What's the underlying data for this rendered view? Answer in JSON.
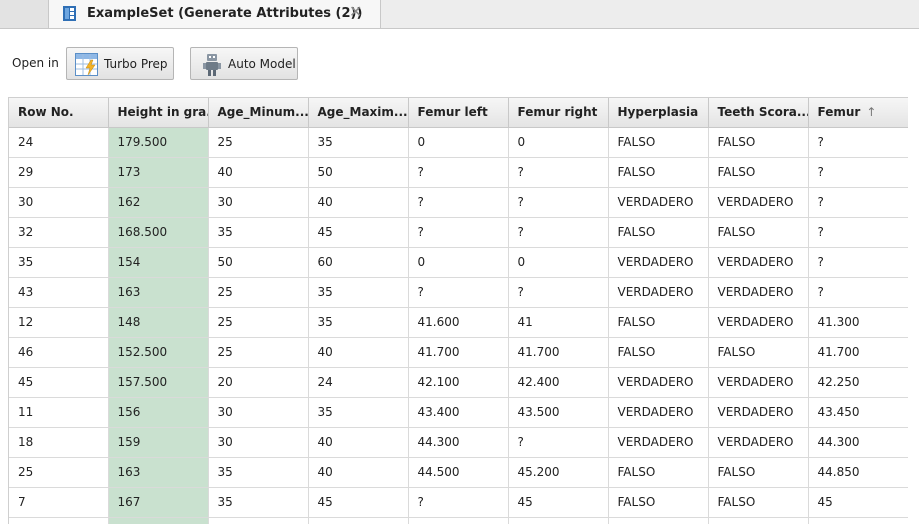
{
  "tab": {
    "title": "ExampleSet (Generate Attributes (2))",
    "close": "✕"
  },
  "toolbar": {
    "open_in_label": "Open in",
    "turbo_prep_label": "Turbo Prep",
    "auto_model_label": "Auto Model"
  },
  "table": {
    "columns": [
      "Row No.",
      "Height in gra...",
      "Age_Minum...",
      "Age_Maxim...",
      "Femur left",
      "Femur right",
      "Hyperplasia",
      "Teeth Scora...",
      "Femur"
    ],
    "sort_indicator": "↑",
    "rows": [
      [
        "24",
        "179.500",
        "25",
        "35",
        "0",
        "0",
        "FALSO",
        "FALSO",
        "?"
      ],
      [
        "29",
        "173",
        "40",
        "50",
        "?",
        "?",
        "FALSO",
        "FALSO",
        "?"
      ],
      [
        "30",
        "162",
        "30",
        "40",
        "?",
        "?",
        "VERDADERO",
        "VERDADERO",
        "?"
      ],
      [
        "32",
        "168.500",
        "35",
        "45",
        "?",
        "?",
        "FALSO",
        "FALSO",
        "?"
      ],
      [
        "35",
        "154",
        "50",
        "60",
        "0",
        "0",
        "VERDADERO",
        "VERDADERO",
        "?"
      ],
      [
        "43",
        "163",
        "25",
        "35",
        "?",
        "?",
        "VERDADERO",
        "VERDADERO",
        "?"
      ],
      [
        "12",
        "148",
        "25",
        "35",
        "41.600",
        "41",
        "FALSO",
        "VERDADERO",
        "41.300"
      ],
      [
        "46",
        "152.500",
        "25",
        "40",
        "41.700",
        "41.700",
        "FALSO",
        "FALSO",
        "41.700"
      ],
      [
        "45",
        "157.500",
        "20",
        "24",
        "42.100",
        "42.400",
        "VERDADERO",
        "VERDADERO",
        "42.250"
      ],
      [
        "11",
        "156",
        "30",
        "35",
        "43.400",
        "43.500",
        "VERDADERO",
        "VERDADERO",
        "43.450"
      ],
      [
        "18",
        "159",
        "30",
        "40",
        "44.300",
        "?",
        "VERDADERO",
        "VERDADERO",
        "44.300"
      ],
      [
        "25",
        "163",
        "35",
        "40",
        "44.500",
        "45.200",
        "FALSO",
        "FALSO",
        "44.850"
      ],
      [
        "7",
        "167",
        "35",
        "45",
        "?",
        "45",
        "FALSO",
        "FALSO",
        "45"
      ],
      [
        "",
        "",
        "",
        "",
        "",
        "",
        "",
        "",
        ""
      ]
    ]
  },
  "colors": {
    "highlight_column": "#c9e1cf",
    "tab_icon": "#2f6fb5"
  }
}
